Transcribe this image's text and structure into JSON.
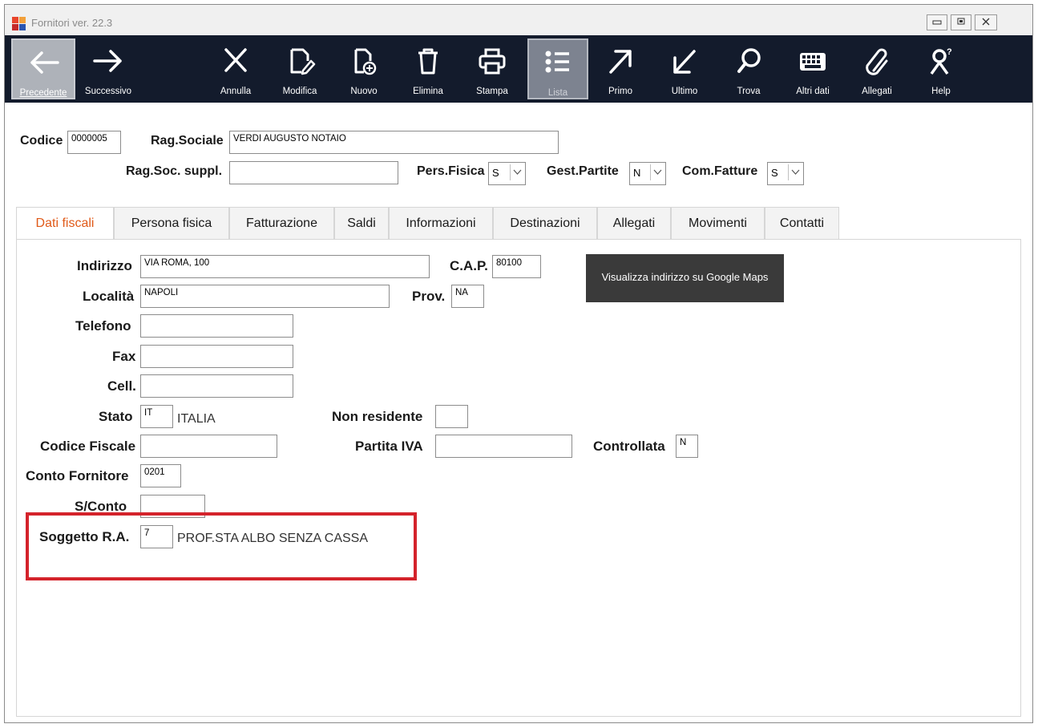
{
  "window": {
    "title": "Fornitori ver. 22.3"
  },
  "toolbar": {
    "buttons": [
      {
        "label": "Precedente",
        "icon": "arrow-left-icon"
      },
      {
        "label": "Successivo",
        "icon": "arrow-right-icon"
      },
      {
        "label": "Annulla",
        "icon": "close-icon"
      },
      {
        "label": "Modifica",
        "icon": "edit-document-icon"
      },
      {
        "label": "Nuovo",
        "icon": "new-document-icon"
      },
      {
        "label": "Elimina",
        "icon": "trash-icon"
      },
      {
        "label": "Stampa",
        "icon": "printer-icon"
      },
      {
        "label": "Lista",
        "icon": "list-icon"
      },
      {
        "label": "Primo",
        "icon": "arrow-up-right-icon"
      },
      {
        "label": "Ultimo",
        "icon": "arrow-down-left-icon"
      },
      {
        "label": "Trova",
        "icon": "search-icon"
      },
      {
        "label": "Altri dati",
        "icon": "keyboard-icon"
      },
      {
        "label": "Allegati",
        "icon": "paperclip-icon"
      },
      {
        "label": "Help",
        "icon": "help-person-icon"
      }
    ]
  },
  "header": {
    "codice_label": "Codice",
    "codice_value": "0000005",
    "rag_sociale_label": "Rag.Sociale",
    "rag_sociale_value": "VERDI AUGUSTO NOTAIO",
    "rag_soc_suppl_label": "Rag.Soc. suppl.",
    "rag_soc_suppl_value": "",
    "pers_fisica_label": "Pers.Fisica",
    "pers_fisica_value": "S",
    "gest_partite_label": "Gest.Partite",
    "gest_partite_value": "N",
    "com_fatture_label": "Com.Fatture",
    "com_fatture_value": "S"
  },
  "tabs": [
    {
      "label": "Dati fiscali"
    },
    {
      "label": "Persona fisica"
    },
    {
      "label": "Fatturazione"
    },
    {
      "label": "Saldi"
    },
    {
      "label": "Informazioni"
    },
    {
      "label": "Destinazioni"
    },
    {
      "label": "Allegati"
    },
    {
      "label": "Movimenti"
    },
    {
      "label": "Contatti"
    }
  ],
  "form": {
    "indirizzo_label": "Indirizzo",
    "indirizzo_value": "VIA ROMA, 100",
    "cap_label": "C.A.P.",
    "cap_value": "80100",
    "maps_button": "Visualizza indirizzo su Google Maps",
    "localita_label": "Località",
    "localita_value": "NAPOLI",
    "prov_label": "Prov.",
    "prov_value": "NA",
    "telefono_label": "Telefono",
    "telefono_value": "",
    "fax_label": "Fax",
    "fax_value": "",
    "cell_label": "Cell.",
    "cell_value": "",
    "stato_label": "Stato",
    "stato_value": "IT",
    "stato_desc": "ITALIA",
    "non_residente_label": "Non residente",
    "non_residente_value": "",
    "codice_fiscale_label": "Codice Fiscale",
    "codice_fiscale_value": "",
    "partita_iva_label": "Partita IVA",
    "partita_iva_value": "",
    "controllata_label": "Controllata",
    "controllata_value": "N",
    "conto_fornitore_label": "Conto Fornitore",
    "conto_fornitore_value": "0201",
    "sconto_label": "S/Conto",
    "sconto_value": "",
    "soggetto_ra_label": "Soggetto R.A.",
    "soggetto_ra_value": "7",
    "soggetto_ra_desc": "PROF.STA ALBO SENZA CASSA"
  },
  "colors": {
    "toolbar_bg": "#131b2c",
    "active_tab_text": "#e05a19",
    "highlight_border": "#d4232b"
  }
}
